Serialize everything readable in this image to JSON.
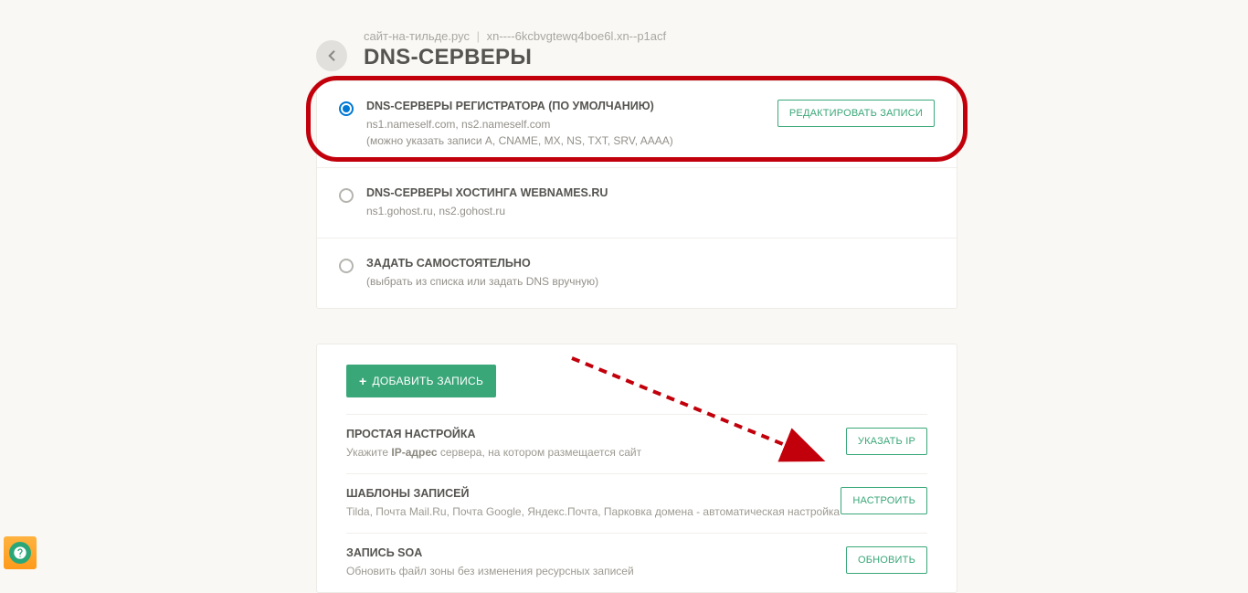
{
  "header": {
    "domain_display": "сайт-на-тильде.рус",
    "domain_punycode": "xn----6kcbvgtewq4boe6l.xn--p1acf",
    "title": "DNS-СЕРВЕРЫ"
  },
  "options": [
    {
      "title": "DNS-СЕРВЕРЫ РЕГИСТРАТОРА (ПО УМОЛЧАНИЮ)",
      "line1": "ns1.nameself.com, ns2.nameself.com",
      "line2": "(можно указать записи A, CNAME, MX, NS, TXT, SRV, AAAA)",
      "selected": true,
      "action": "РЕДАКТИРОВАТЬ ЗАПИСИ"
    },
    {
      "title": "DNS-СЕРВЕРЫ ХОСТИНГА WEBNAMES.RU",
      "line1": "ns1.gohost.ru, ns2.gohost.ru",
      "selected": false
    },
    {
      "title": "ЗАДАТЬ САМОСТОЯТЕЛЬНО",
      "line1": "(выбрать из списка или задать DNS вручную)",
      "selected": false
    }
  ],
  "add_button": "ДОБАВИТЬ ЗАПИСЬ",
  "sections": [
    {
      "title": "ПРОСТАЯ НАСТРОЙКА",
      "sub_prefix": "Укажите ",
      "sub_bold": "IP-адрес",
      "sub_suffix": " сервера, на котором размещается сайт",
      "action": "УКАЗАТЬ IP"
    },
    {
      "title": "ШАБЛОНЫ ЗАПИСЕЙ",
      "sub": "Tilda, Почта Mail.Ru, Почта Google, Яндекс.Почта, Парковка домена - автоматическая настройка",
      "action": "НАСТРОИТЬ"
    },
    {
      "title": "ЗАПИСЬ SOA",
      "sub": "Обновить файл зоны без изменения ресурсных записей",
      "action": "ОБНОВИТЬ"
    }
  ],
  "help_icon_label": "?"
}
